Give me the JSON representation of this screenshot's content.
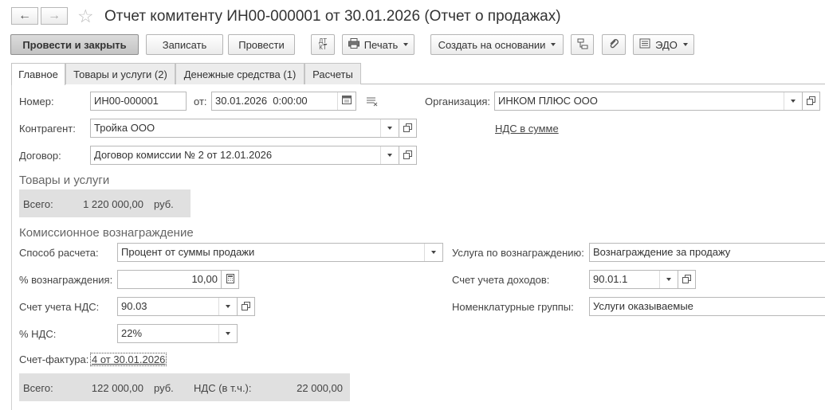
{
  "window": {
    "title": "Отчет комитенту ИН00-000001 от 30.01.2026 (Отчет о продажах)"
  },
  "toolbar": {
    "post_close_label": "Провести и закрыть",
    "save_label": "Записать",
    "post_label": "Провести",
    "dtkt_top": "ДТ",
    "dtkt_bottom": "КТ",
    "print_label": "Печать",
    "create_based_label": "Создать на основании",
    "edo_label": "ЭДО"
  },
  "tabs": [
    {
      "label": "Главное"
    },
    {
      "label": "Товары и услуги (2)"
    },
    {
      "label": "Денежные средства (1)"
    },
    {
      "label": "Расчеты"
    }
  ],
  "form": {
    "number_label": "Номер:",
    "number_value": "ИН00-000001",
    "date_label": "от:",
    "date_value": "30.01.2026  0:00:00",
    "org_label": "Организация:",
    "org_value": "ИНКОМ ПЛЮС ООО",
    "contractor_label": "Контрагент:",
    "contractor_value": "Тройка ООО",
    "vat_link": "НДС в сумме",
    "contract_label": "Договор:",
    "contract_value": "Договор комиссии № 2 от 12.01.2026"
  },
  "goods": {
    "section_title": "Товары и услуги",
    "total_label": "Всего:",
    "total_value": "1 220 000,00",
    "currency": "руб."
  },
  "commission": {
    "section_title": "Комиссионное вознаграждение",
    "method_label": "Способ расчета:",
    "method_value": "Процент от суммы продажи",
    "service_label": "Услуга по вознаграждению:",
    "service_value": "Вознаграждение за продажу",
    "percent_label": "% вознаграждения:",
    "percent_value": "10,00",
    "income_account_label": "Счет учета доходов:",
    "income_account_value": "90.01.1",
    "vat_account_label": "Счет учета НДС:",
    "vat_account_value": "90.03",
    "nomenclature_label": "Номенклатурные группы:",
    "nomenclature_value": "Услуги оказываемые",
    "vat_rate_label": "% НДС:",
    "vat_rate_value": "22%",
    "invoice_label": "Счет-фактура:",
    "invoice_link": "4 от 30.01.2026",
    "total_label": "Всего:",
    "total_value": "122 000,00",
    "currency": "руб.",
    "vat_incl_label": "НДС (в т.ч.):",
    "vat_incl_value": "22 000,00"
  }
}
